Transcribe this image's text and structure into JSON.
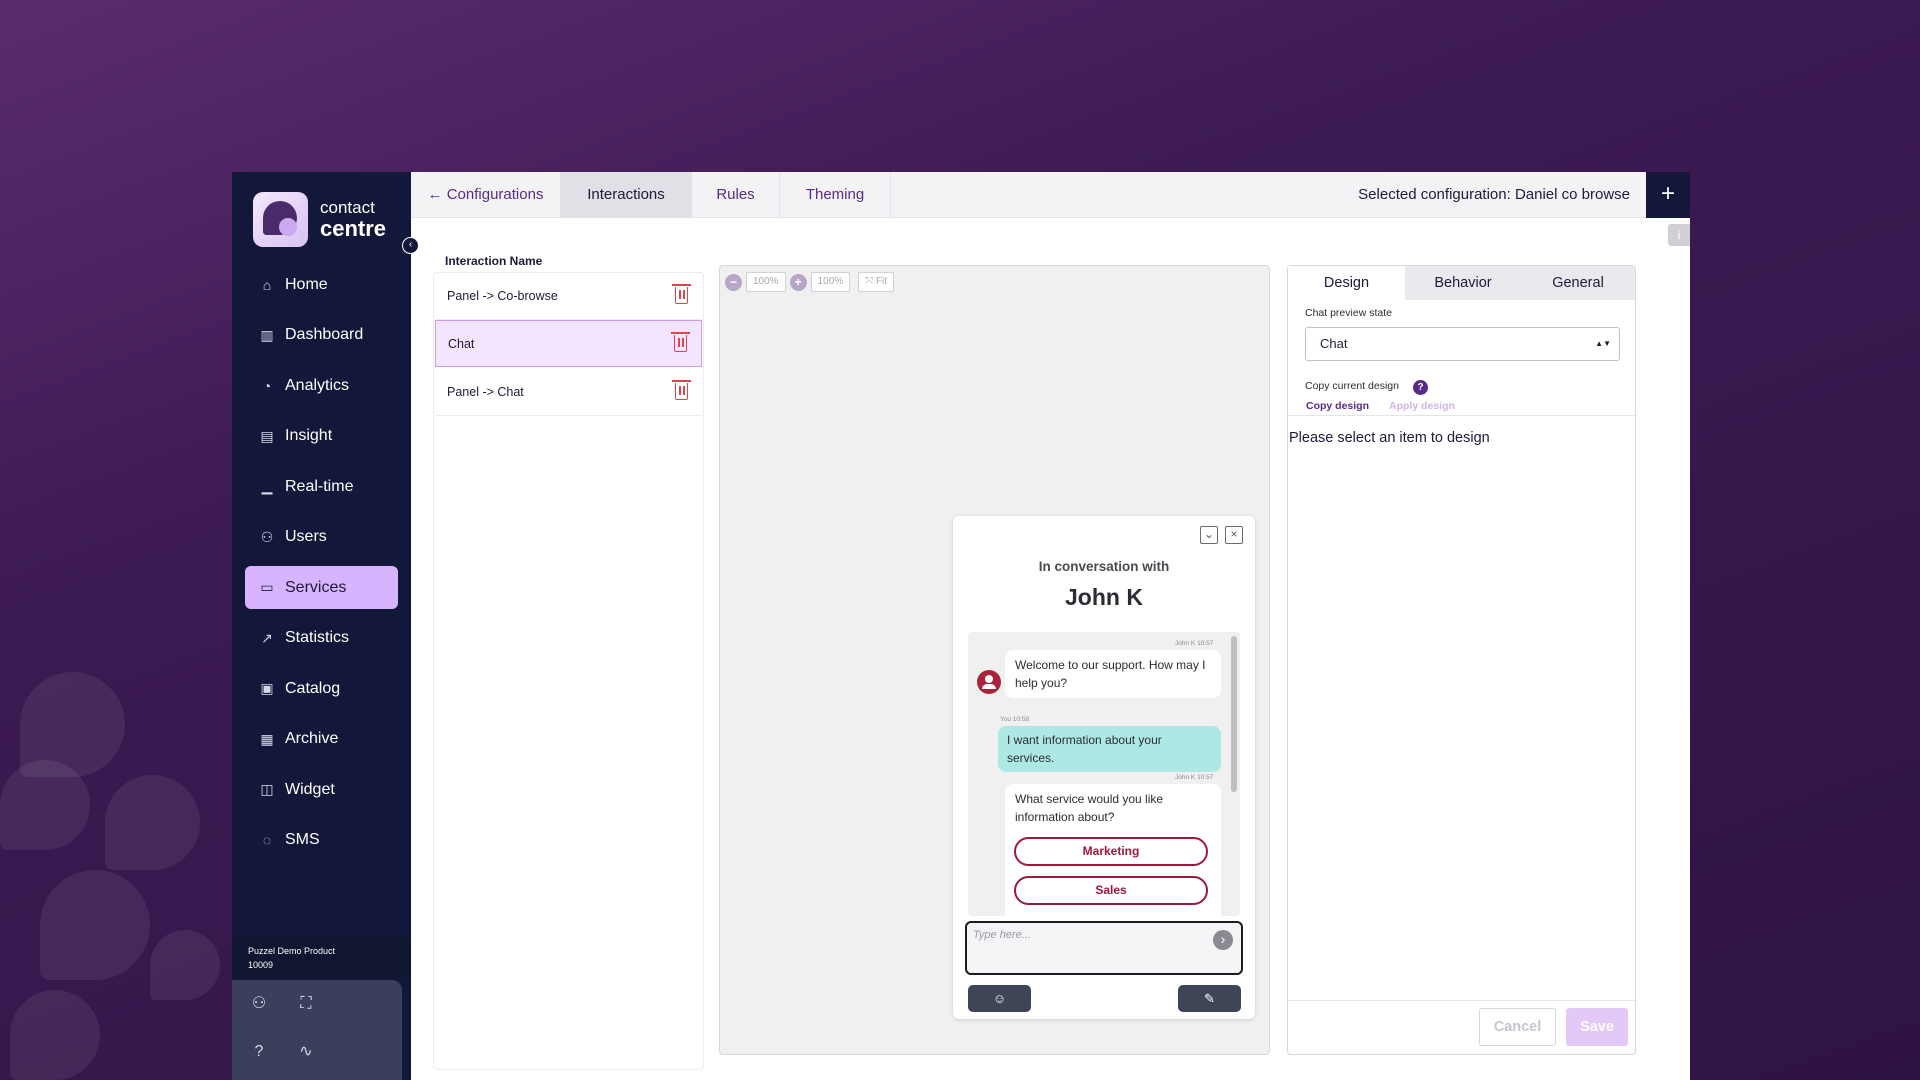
{
  "brand": {
    "line1": "contact",
    "line2": "centre"
  },
  "sidebar": {
    "items": [
      {
        "label": "Home",
        "icon": "⌂"
      },
      {
        "label": "Dashboard",
        "icon": "▥"
      },
      {
        "label": "Analytics",
        "icon": "◔"
      },
      {
        "label": "Insight",
        "icon": "▤"
      },
      {
        "label": "Real-time",
        "icon": "▁"
      },
      {
        "label": "Users",
        "icon": "⚇"
      },
      {
        "label": "Services",
        "icon": "▭"
      },
      {
        "label": "Statistics",
        "icon": "↗"
      },
      {
        "label": "Catalog",
        "icon": "▣"
      },
      {
        "label": "Archive",
        "icon": "▦"
      },
      {
        "label": "Widget",
        "icon": "◫"
      },
      {
        "label": "SMS",
        "icon": "◌"
      }
    ],
    "active_item": "Services",
    "product_name": "Puzzel Demo Product",
    "product_id": "10009"
  },
  "topbar": {
    "back_label": "Configurations",
    "tabs": [
      "Interactions",
      "Rules",
      "Theming"
    ],
    "active_tab": "Interactions",
    "selected_config": "Selected configuration: Daniel co browse"
  },
  "interactions": {
    "heading": "Interaction Name",
    "items": [
      "Panel -> Co-browse",
      "Chat",
      "Panel -> Chat"
    ],
    "selected": "Chat"
  },
  "preview": {
    "zoom_values": [
      "100%",
      "100%"
    ],
    "fit_label": "Fit",
    "chat": {
      "header_line": "In conversation with",
      "agent_name": "John K",
      "messages": [
        {
          "sender": "John K",
          "time": "10:57",
          "text": "Welcome to our support. How may I help you?"
        },
        {
          "sender": "You",
          "time": "10:58",
          "text": "I want information about your services."
        },
        {
          "sender": "John K",
          "time": "10:57",
          "text": "What service would you like information about?"
        }
      ],
      "options": [
        "Marketing",
        "Sales"
      ],
      "input_placeholder": "Type here..."
    }
  },
  "design_panel": {
    "tabs": [
      "Design",
      "Behavior",
      "General"
    ],
    "active_tab": "Design",
    "preview_state_label": "Chat preview state",
    "preview_state_value": "Chat",
    "copy_label": "Copy current design",
    "copy_button": "Copy design",
    "apply_button": "Apply design",
    "empty_message": "Please select an item to design",
    "cancel_label": "Cancel",
    "save_label": "Save"
  },
  "colors": {
    "sidebar_bg": "#13183a",
    "active_nav_bg": "#d8b4fe",
    "accent_purple": "#5a2a8a",
    "option_red": "#9a1b3c",
    "user_bubble": "#aee8e4"
  }
}
